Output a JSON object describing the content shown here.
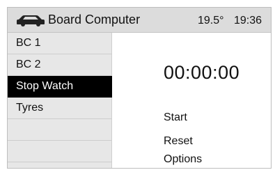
{
  "header": {
    "title": "Board Computer",
    "temperature": "19.5°",
    "time": "19:36",
    "icon": "car-icon"
  },
  "sidebar": {
    "items": [
      {
        "label": "BC 1",
        "selected": false
      },
      {
        "label": "BC 2",
        "selected": false
      },
      {
        "label": "Stop Watch",
        "selected": true
      },
      {
        "label": "Tyres",
        "selected": false
      },
      {
        "label": "",
        "selected": false
      },
      {
        "label": "",
        "selected": false
      }
    ]
  },
  "main": {
    "timer": "00:00:00",
    "actions": [
      "Start",
      "Reset",
      "Options"
    ]
  },
  "colors": {
    "header_bg": "#dcdcdc",
    "sidebar_bg": "#e7e7e7",
    "selected_bg": "#000000",
    "selected_fg": "#ffffff"
  }
}
